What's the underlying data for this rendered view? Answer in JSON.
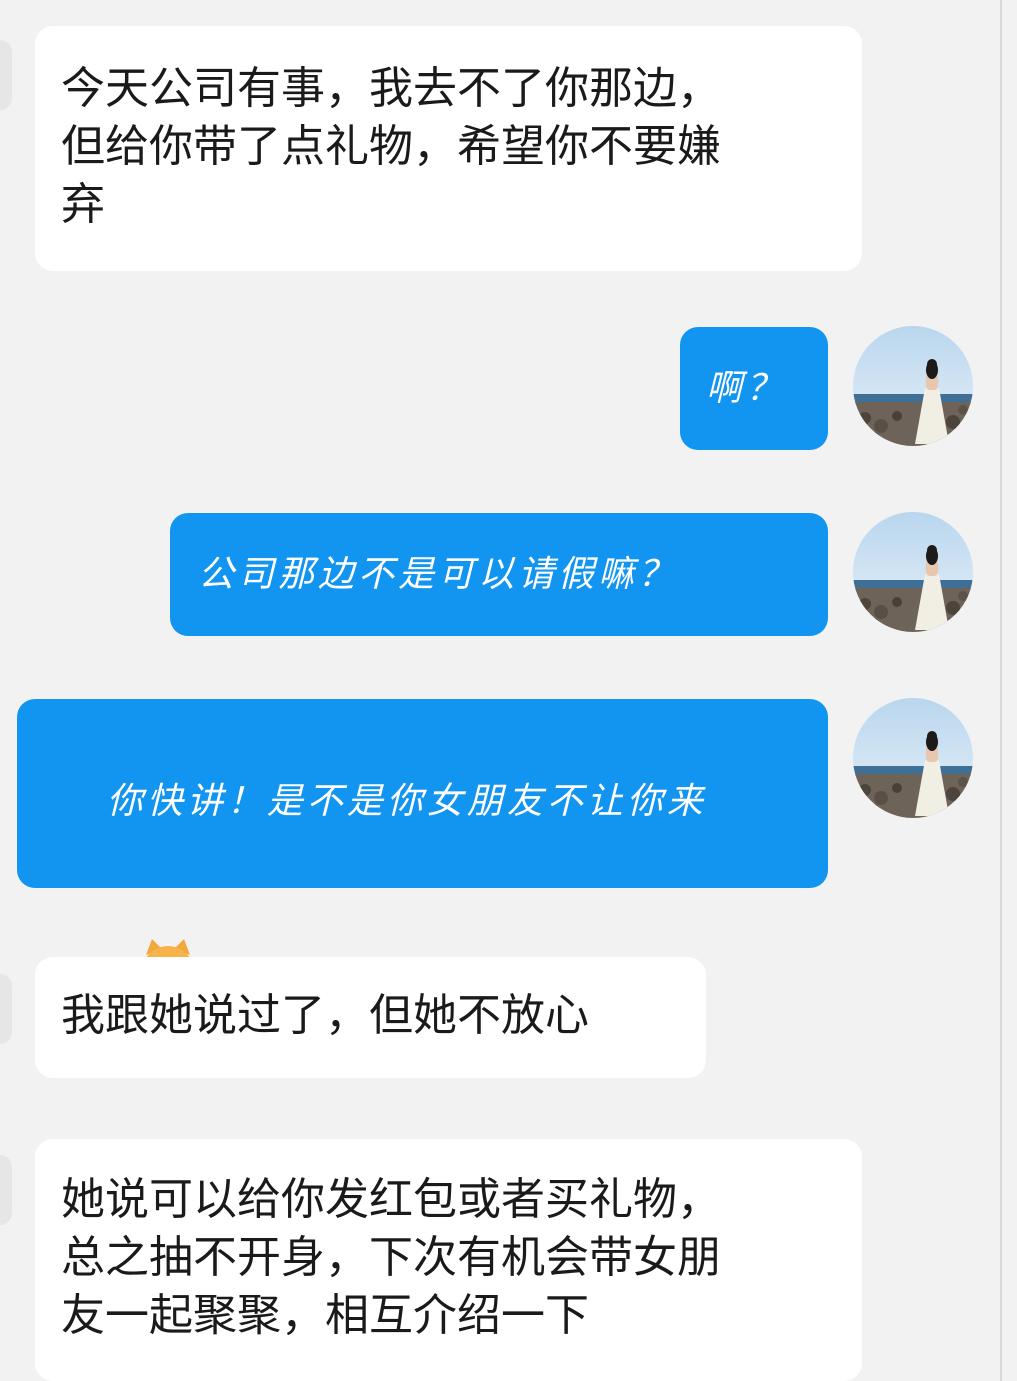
{
  "messages": [
    {
      "direction": "incoming",
      "text": "今天公司有事，我去不了你那边，\n但给你带了点礼物，希望你不要嫌\n弃"
    },
    {
      "direction": "outgoing",
      "text": "啊？"
    },
    {
      "direction": "outgoing",
      "text": "公司那边不是可以请假嘛？"
    },
    {
      "direction": "outgoing",
      "text": "你快讲！是不是你女朋友不让你来",
      "emoji": "shiba-dog-emoji"
    },
    {
      "direction": "incoming",
      "text": "我跟她说过了，但她不放心"
    },
    {
      "direction": "incoming",
      "text": "她说可以给你发红包或者买礼物，\n总之抽不开身，下次有机会带女朋\n友一起聚聚，相互介绍一下"
    }
  ],
  "avatar": {
    "icon": "profile-photo-woman-seaside"
  },
  "colors": {
    "outgoing_bubble": "#1195f0",
    "incoming_bubble": "#ffffff",
    "background": "#f2f2f2"
  }
}
